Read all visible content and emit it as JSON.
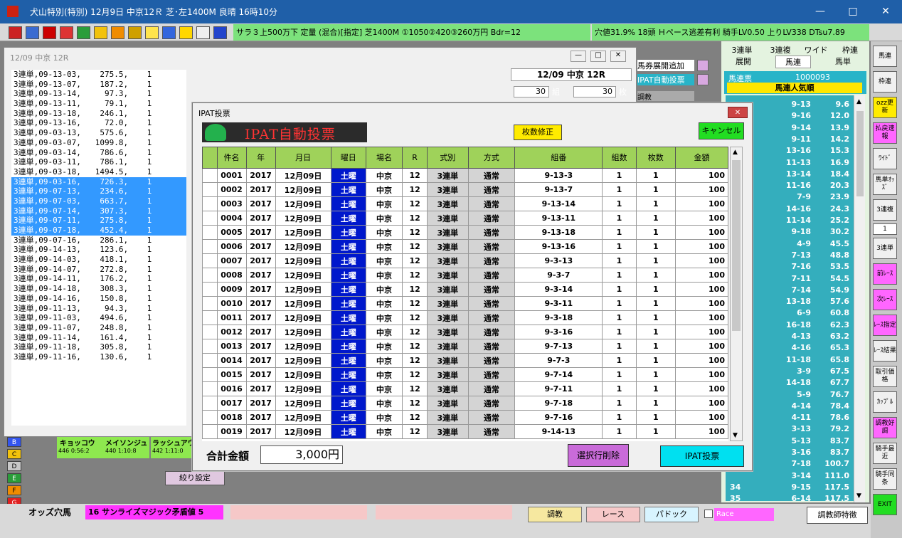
{
  "window": {
    "title": "犬山特別(特別)  12月9日  中京12Ｒ  芝･左1400M  良晴  16時10分"
  },
  "race_info": {
    "left": "サラ３上500万下  定量 (混合)[指定]  芝1400M ①1050②420③260万円 Bdr=12",
    "right": "穴値31.9% 18頭  Ｈペース逃差有利 騎手LV0.50 上りLV338 DTsu7.89"
  },
  "side_buttons": [
    "馬券展開追加",
    "IPAT自動投票",
    "調教"
  ],
  "left_window": {
    "title": "12/09 中京 12R",
    "race_label": "12/09 中京 12R",
    "kumi_value": "30",
    "kumi_unit": "組",
    "mai_value": "30",
    "mai_unit": "枚",
    "lines": [
      "3連単,09-13-03,    275.5,    1",
      "3連単,09-13-07,    187.2,    1",
      "3連単,09-13-14,     97.3,    1",
      "3連単,09-13-11,     79.1,    1",
      "3連単,09-13-18,    246.1,    1",
      "3連単,09-13-16,     72.0,    1",
      "3連単,09-03-13,    575.6,    1",
      "3連単,09-03-07,   1099.8,    1",
      "3連単,09-03-14,    786.6,    1",
      "3連単,09-03-11,    786.1,    1",
      "3連単,09-03-18,   1494.5,    1",
      "3連単,09-03-16,    726.3,    1",
      "3連単,09-07-13,    234.6,    1",
      "3連単,09-07-03,    663.7,    1",
      "3連単,09-07-14,    307.3,    1",
      "3連単,09-07-11,    275.8,    1",
      "3連単,09-07-18,    452.4,    1",
      "3連単,09-07-16,    286.1,    1",
      "3連単,09-14-13,    123.6,    1",
      "3連単,09-14-03,    418.1,    1",
      "3連単,09-14-07,    272.8,    1",
      "3連単,09-14-11,    176.2,    1",
      "3連単,09-14-18,    308.3,    1",
      "3連単,09-14-16,    150.8,    1",
      "3連単,09-11-13,     94.3,    1",
      "3連単,09-11-03,    494.6,    1",
      "3連単,09-11-07,    248.8,    1",
      "3連単,09-11-14,    161.4,    1",
      "3連単,09-11-18,    305.8,    1",
      "3連単,09-11-16,    130.6,    1"
    ]
  },
  "dialog": {
    "title": "IPAT投票",
    "header": "IPAT自動投票",
    "fix_button": "枚数修正",
    "cancel_button": "キャンセル",
    "columns": [
      "件名",
      "年",
      "月日",
      "曜日",
      "場名",
      "R",
      "式別",
      "方式",
      "組番",
      "組数",
      "枚数",
      "金額"
    ],
    "rows": [
      [
        "0001",
        "2017",
        "12月09日",
        "土曜",
        "中京",
        "12",
        "3連単",
        "通常",
        "9-13-3",
        "1",
        "1",
        "100"
      ],
      [
        "0002",
        "2017",
        "12月09日",
        "土曜",
        "中京",
        "12",
        "3連単",
        "通常",
        "9-13-7",
        "1",
        "1",
        "100"
      ],
      [
        "0003",
        "2017",
        "12月09日",
        "土曜",
        "中京",
        "12",
        "3連単",
        "通常",
        "9-13-14",
        "1",
        "1",
        "100"
      ],
      [
        "0004",
        "2017",
        "12月09日",
        "土曜",
        "中京",
        "12",
        "3連単",
        "通常",
        "9-13-11",
        "1",
        "1",
        "100"
      ],
      [
        "0005",
        "2017",
        "12月09日",
        "土曜",
        "中京",
        "12",
        "3連単",
        "通常",
        "9-13-18",
        "1",
        "1",
        "100"
      ],
      [
        "0006",
        "2017",
        "12月09日",
        "土曜",
        "中京",
        "12",
        "3連単",
        "通常",
        "9-13-16",
        "1",
        "1",
        "100"
      ],
      [
        "0007",
        "2017",
        "12月09日",
        "土曜",
        "中京",
        "12",
        "3連単",
        "通常",
        "9-3-13",
        "1",
        "1",
        "100"
      ],
      [
        "0008",
        "2017",
        "12月09日",
        "土曜",
        "中京",
        "12",
        "3連単",
        "通常",
        "9-3-7",
        "1",
        "1",
        "100"
      ],
      [
        "0009",
        "2017",
        "12月09日",
        "土曜",
        "中京",
        "12",
        "3連単",
        "通常",
        "9-3-14",
        "1",
        "1",
        "100"
      ],
      [
        "0010",
        "2017",
        "12月09日",
        "土曜",
        "中京",
        "12",
        "3連単",
        "通常",
        "9-3-11",
        "1",
        "1",
        "100"
      ],
      [
        "0011",
        "2017",
        "12月09日",
        "土曜",
        "中京",
        "12",
        "3連単",
        "通常",
        "9-3-18",
        "1",
        "1",
        "100"
      ],
      [
        "0012",
        "2017",
        "12月09日",
        "土曜",
        "中京",
        "12",
        "3連単",
        "通常",
        "9-3-16",
        "1",
        "1",
        "100"
      ],
      [
        "0013",
        "2017",
        "12月09日",
        "土曜",
        "中京",
        "12",
        "3連単",
        "通常",
        "9-7-13",
        "1",
        "1",
        "100"
      ],
      [
        "0014",
        "2017",
        "12月09日",
        "土曜",
        "中京",
        "12",
        "3連単",
        "通常",
        "9-7-3",
        "1",
        "1",
        "100"
      ],
      [
        "0015",
        "2017",
        "12月09日",
        "土曜",
        "中京",
        "12",
        "3連単",
        "通常",
        "9-7-14",
        "1",
        "1",
        "100"
      ],
      [
        "0016",
        "2017",
        "12月09日",
        "土曜",
        "中京",
        "12",
        "3連単",
        "通常",
        "9-7-11",
        "1",
        "1",
        "100"
      ],
      [
        "0017",
        "2017",
        "12月09日",
        "土曜",
        "中京",
        "12",
        "3連単",
        "通常",
        "9-7-18",
        "1",
        "1",
        "100"
      ],
      [
        "0018",
        "2017",
        "12月09日",
        "土曜",
        "中京",
        "12",
        "3連単",
        "通常",
        "9-7-16",
        "1",
        "1",
        "100"
      ],
      [
        "0019",
        "2017",
        "12月09日",
        "土曜",
        "中京",
        "12",
        "3連単",
        "通常",
        "9-14-13",
        "1",
        "1",
        "100"
      ]
    ],
    "total_label": "合計金額",
    "total_value": "3,000円",
    "delete_button": "選択行削除",
    "vote_button": "IPAT投票"
  },
  "odds_panel": {
    "tabs_row1": [
      "3連単",
      "3連複",
      "ワイド",
      "枠連"
    ],
    "tabs_row2": [
      "展開",
      "馬連",
      "馬単"
    ],
    "header": "馬連票",
    "header_value": "1000093",
    "subheader": "馬連人気順",
    "rows": [
      [
        "",
        "9-13",
        "9.6"
      ],
      [
        "",
        "9-16",
        "12.0"
      ],
      [
        "",
        "9-14",
        "13.9"
      ],
      [
        "",
        "9-11",
        "14.2"
      ],
      [
        "",
        "13-16",
        "15.3"
      ],
      [
        "",
        "11-13",
        "16.9"
      ],
      [
        "",
        "13-14",
        "18.4"
      ],
      [
        "",
        "11-16",
        "20.3"
      ],
      [
        "",
        "7-9",
        "23.9"
      ],
      [
        "",
        "14-16",
        "24.3"
      ],
      [
        "",
        "11-14",
        "25.2"
      ],
      [
        "",
        "9-18",
        "30.2"
      ],
      [
        "",
        "4-9",
        "45.5"
      ],
      [
        "",
        "7-13",
        "48.8"
      ],
      [
        "",
        "7-16",
        "53.5"
      ],
      [
        "",
        "7-11",
        "54.5"
      ],
      [
        "",
        "7-14",
        "54.9"
      ],
      [
        "",
        "13-18",
        "57.6"
      ],
      [
        "",
        "6-9",
        "60.8"
      ],
      [
        "",
        "16-18",
        "62.3"
      ],
      [
        "",
        "4-13",
        "63.2"
      ],
      [
        "",
        "4-16",
        "65.3"
      ],
      [
        "",
        "11-18",
        "65.8"
      ],
      [
        "",
        "3-9",
        "67.5"
      ],
      [
        "",
        "14-18",
        "67.7"
      ],
      [
        "",
        "5-9",
        "76.7"
      ],
      [
        "",
        "4-14",
        "78.4"
      ],
      [
        "",
        "4-11",
        "78.6"
      ],
      [
        "",
        "3-13",
        "79.2"
      ],
      [
        "",
        "5-13",
        "83.7"
      ],
      [
        "",
        "3-16",
        "83.7"
      ],
      [
        "",
        "7-18",
        "100.7"
      ],
      [
        "",
        "3-14",
        "111.0"
      ],
      [
        "34",
        "9-15",
        "117.5"
      ],
      [
        "35",
        "6-14",
        "117.5"
      ]
    ]
  },
  "right_buttons": [
    "馬連",
    "枠連",
    "ozz更新",
    "払戻速報",
    "ﾜｲﾄﾞ",
    "馬単ｵｯｽﾞ",
    "3連複",
    "1",
    "3連単",
    "前ﾚｰｽ",
    "次ﾚｰｽ",
    "ﾚｰｽ指定",
    "ﾚｰｽ結果",
    "取引価格",
    "ｶｯﾌﾟﾙ",
    "調教好調",
    "騎手最近",
    "騎手同条",
    "EXIT"
  ],
  "horses": [
    {
      "name": "キョッコウ",
      "stats": "446  0:56:2"
    },
    {
      "name": "メイソンジュ",
      "stats": "440  1:10:8"
    },
    {
      "name": "ラッシュアウ",
      "stats": "442  1:11:0"
    }
  ],
  "filter_button": "絞り設定",
  "legend": [
    "B",
    "C",
    "D",
    "E",
    "F",
    "G"
  ],
  "status": {
    "label": "オッズ穴馬",
    "horse": "16 サンライズマジック矛盾値  5",
    "btn_chokyo": "調教",
    "btn_race": "レース",
    "btn_paddock": "パドック",
    "check_race": "Race",
    "btn_trainer": "調教師特徴"
  }
}
